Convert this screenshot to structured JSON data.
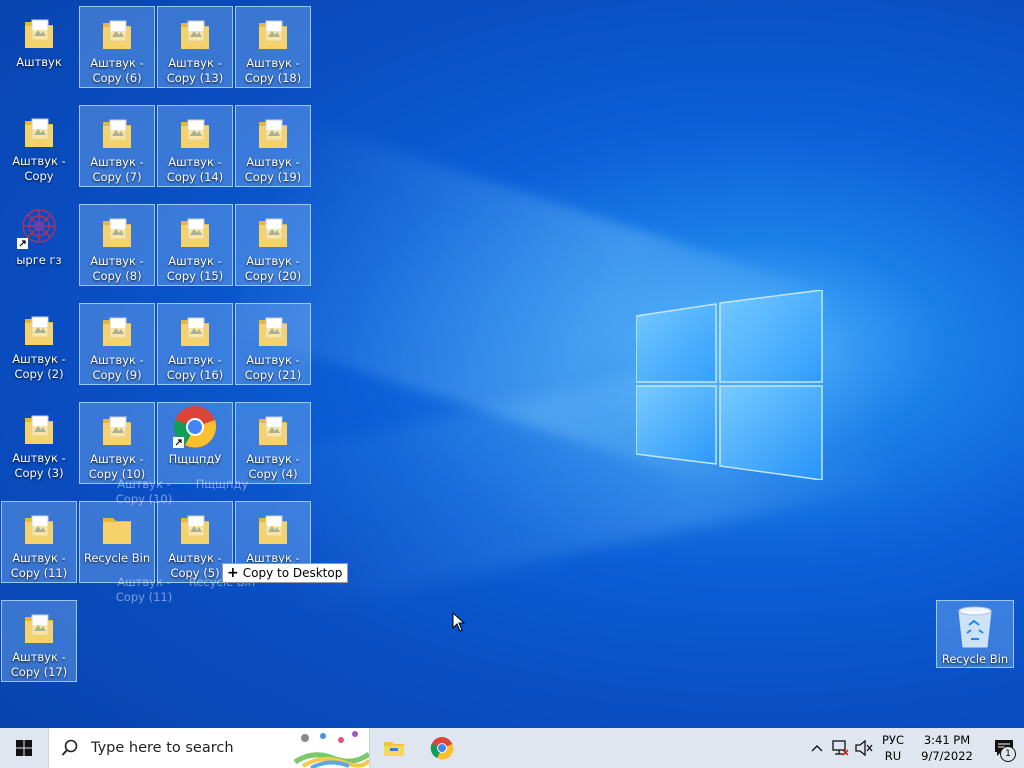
{
  "desktop": {
    "icons": [
      {
        "name": "Аштвук",
        "type": "folder",
        "selected": false
      },
      {
        "name": "Аштвук - Copy (6)",
        "type": "folder",
        "selected": true
      },
      {
        "name": "Аштвук - Copy (13)",
        "type": "folder",
        "selected": true
      },
      {
        "name": "Аштвук - Copy (18)",
        "type": "folder",
        "selected": true
      },
      {
        "name": "Аштвук - Copy",
        "type": "folder",
        "selected": false
      },
      {
        "name": "Аштвук - Copy (7)",
        "type": "folder",
        "selected": true
      },
      {
        "name": "Аштвук - Copy (14)",
        "type": "folder",
        "selected": true
      },
      {
        "name": "Аштвук - Copy (19)",
        "type": "folder",
        "selected": true
      },
      {
        "name": "ырге гз",
        "type": "shortcut-app",
        "selected": false
      },
      {
        "name": "Аштвук - Copy (8)",
        "type": "folder",
        "selected": true
      },
      {
        "name": "Аштвук - Copy (15)",
        "type": "folder",
        "selected": true
      },
      {
        "name": "Аштвук - Copy (20)",
        "type": "folder",
        "selected": true
      },
      {
        "name": "Аштвук - Copy (2)",
        "type": "folder",
        "selected": false
      },
      {
        "name": "Аштвук - Copy (9)",
        "type": "folder",
        "selected": true
      },
      {
        "name": "Аштвук - Copy (16)",
        "type": "folder",
        "selected": true
      },
      {
        "name": "Аштвук - Copy (21)",
        "type": "folder",
        "selected": true
      },
      {
        "name": "Аштвук - Copy (3)",
        "type": "folder",
        "selected": false
      },
      {
        "name": "Аштвук - Copy (10)",
        "type": "folder",
        "selected": true
      },
      {
        "name": "ПщщпдУ",
        "type": "chrome-shortcut",
        "selected": true
      },
      {
        "name": "Аштвук - Copy (4)",
        "type": "folder",
        "selected": true
      },
      {
        "name": "Аштвук - Copy (11)",
        "type": "folder",
        "selected": true
      },
      {
        "name": "Recycle Bin",
        "type": "folder-plain",
        "selected": true
      },
      {
        "name": "Аштвук - Copy (5)",
        "type": "folder",
        "selected": true
      },
      {
        "name": "Аштвук - Copy (12)",
        "type": "folder",
        "selected": true
      },
      {
        "name": "Аштвук - Copy (17)",
        "type": "folder",
        "selected": true
      }
    ],
    "drag_ghost_labels": [
      "Аштвук - Copy (10)",
      "Пщщпду",
      "Аштвук - Copy (11)",
      "Recycle Bin"
    ],
    "drag_tooltip": "Copy to Desktop",
    "recycle_bin": {
      "label": "Recycle Bin"
    }
  },
  "taskbar": {
    "search_placeholder": "Type here to search",
    "pinned": [
      "file-explorer-icon",
      "chrome-icon"
    ],
    "tray": {
      "lang_top": "РУС",
      "lang_bottom": "RU",
      "time": "3:41 PM",
      "date": "9/7/2022",
      "notification_count": "1"
    }
  },
  "colors": {
    "accent": "#0b5ed7",
    "folder": "#f6d26b",
    "taskbar": "#dfe6ef"
  }
}
